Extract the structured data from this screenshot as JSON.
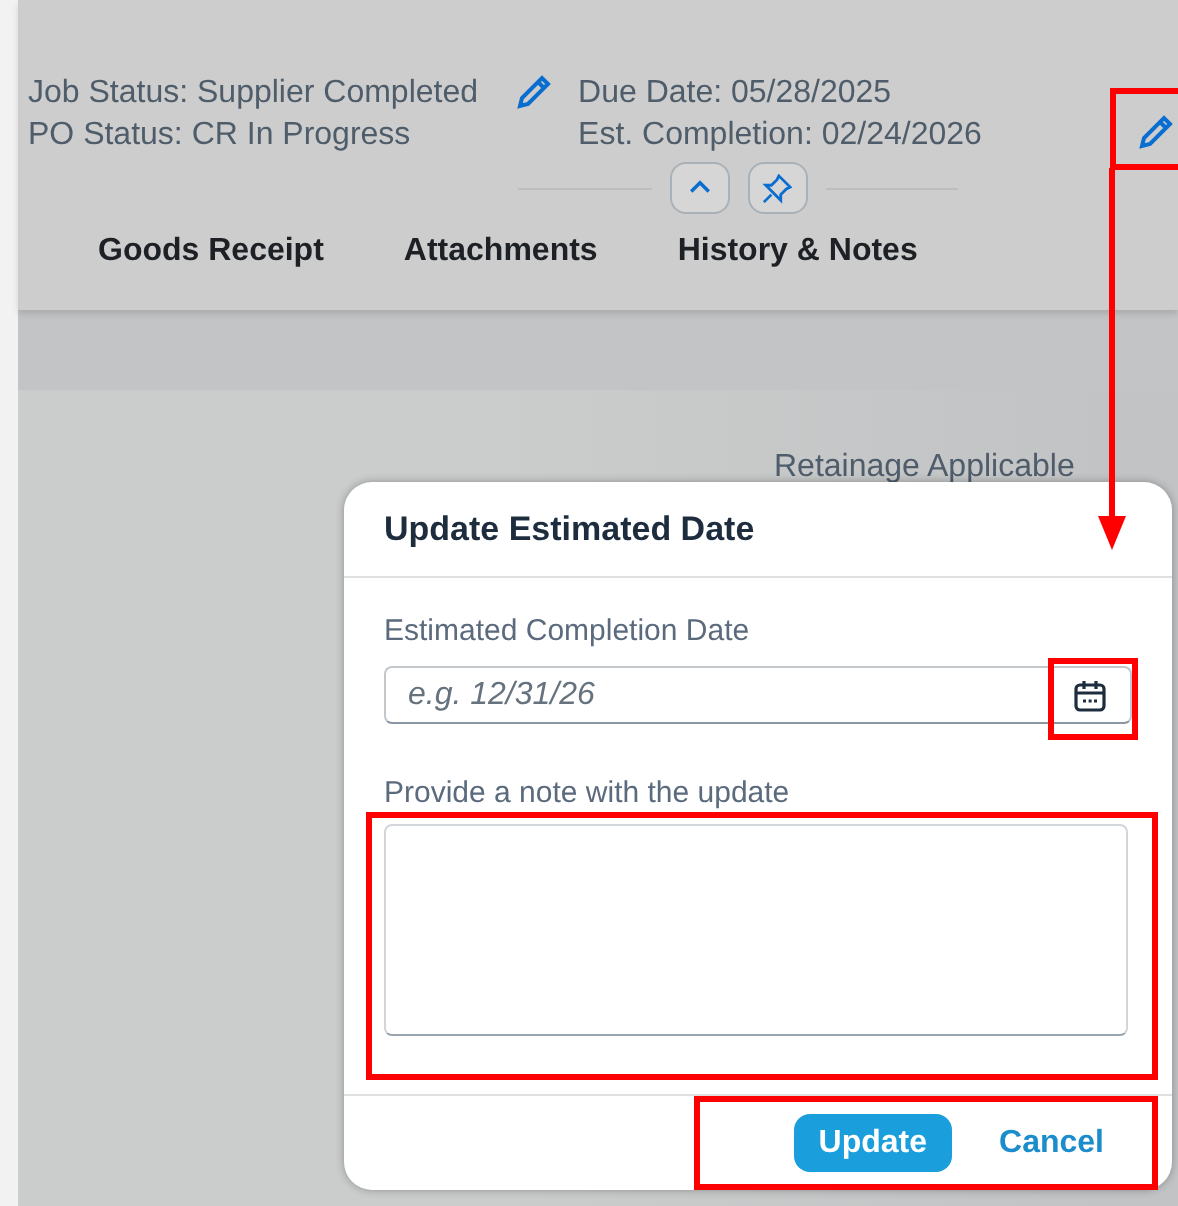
{
  "header": {
    "status_lines": [
      "Job Status: Supplier Completed",
      "PO Status: CR In Progress"
    ],
    "date_lines": [
      "Due Date: 05/28/2025",
      "Est. Completion: 02/24/2026"
    ]
  },
  "tabs": [
    "Goods Receipt",
    "Attachments",
    "History & Notes"
  ],
  "background_label": "Retainage Applicable",
  "dialog": {
    "title": "Update Estimated Date",
    "fields": [
      {
        "kind": "date",
        "label": "Estimated Completion Date",
        "placeholder": "e.g. 12/31/26"
      },
      {
        "kind": "textarea",
        "label": "Provide a note with the update"
      }
    ],
    "buttons": [
      {
        "kind": "primary",
        "label": "Update"
      },
      {
        "kind": "link",
        "label": "Cancel"
      }
    ]
  }
}
